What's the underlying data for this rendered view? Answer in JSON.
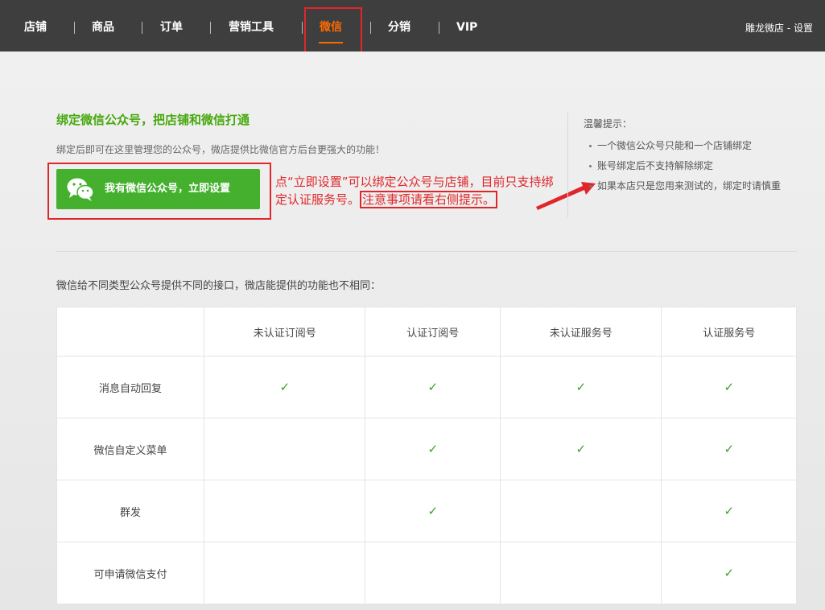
{
  "nav": {
    "items": [
      "店铺",
      "商品",
      "订单",
      "营销工具",
      "微信",
      "分销",
      "VIP"
    ],
    "active_index": 4,
    "right_shop": "雕龙微店",
    "right_sep": " - ",
    "right_settings": "设置"
  },
  "bind": {
    "title": "绑定微信公众号，把店铺和微信打通",
    "desc": "绑定后即可在这里管理您的公众号，微店提供比微信官方后台更强大的功能！",
    "button_label": "我有微信公众号，立即设置"
  },
  "annotation": {
    "line1": "点“立即设置”可以绑定公众号与店铺，目前只支持绑定认证服务号。",
    "highlight": "注意事项请看右侧提示。"
  },
  "tips": {
    "title": "温馨提示：",
    "items": [
      "一个微信公众号只能和一个店铺绑定",
      "账号绑定后不支持解除绑定",
      "如果本店只是您用来测试的，绑定时请慎重"
    ]
  },
  "compare": {
    "intro": "微信给不同类型公众号提供不同的接口，微店能提供的功能也不相同：",
    "columns": [
      "",
      "未认证订阅号",
      "认证订阅号",
      "未认证服务号",
      "认证服务号"
    ],
    "check_symbol": "✓",
    "rows": [
      {
        "feature": "消息自动回复",
        "support": [
          true,
          true,
          true,
          true
        ]
      },
      {
        "feature": "微信自定义菜单",
        "support": [
          false,
          true,
          true,
          true
        ]
      },
      {
        "feature": "群发",
        "support": [
          false,
          true,
          false,
          true
        ]
      },
      {
        "feature": "可申请微信支付",
        "support": [
          false,
          false,
          false,
          true
        ]
      }
    ]
  },
  "colors": {
    "nav_bg": "#3e3e3e",
    "nav_active": "#ff6a00",
    "brand_green": "#44b02e",
    "annotation_red": "#e0262a"
  }
}
